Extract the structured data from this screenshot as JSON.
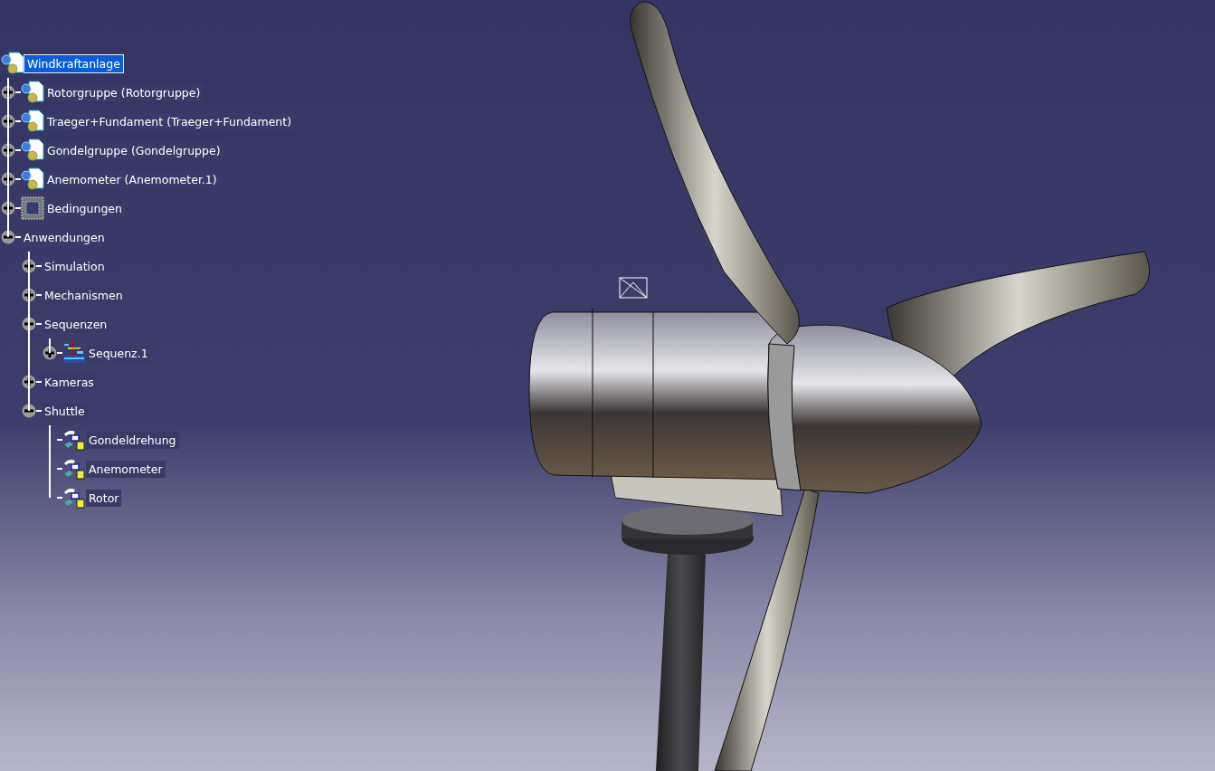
{
  "tree": {
    "label": "Windkraftanlage",
    "kind": "product",
    "selected": true,
    "children": [
      {
        "label": "Rotorgruppe (Rotorgruppe)",
        "kind": "product",
        "selected": false,
        "expanded": false
      },
      {
        "label": "Traeger+Fundament (Traeger+Fundament)",
        "kind": "product",
        "selected": false,
        "expanded": false
      },
      {
        "label": "Gondelgruppe (Gondelgruppe)",
        "kind": "product",
        "selected": false,
        "expanded": false
      },
      {
        "label": "Anemometer (Anemometer.1)",
        "kind": "product",
        "selected": false,
        "expanded": false
      },
      {
        "label": "Bedingungen",
        "kind": "constraints",
        "selected": false,
        "expanded": false
      },
      {
        "label": "Anwendungen",
        "selected": false,
        "expanded": true,
        "children": [
          {
            "label": "Simulation",
            "selected": false,
            "expanded": false
          },
          {
            "label": "Mechanismen",
            "selected": false,
            "expanded": false
          },
          {
            "label": "Sequenzen",
            "selected": false,
            "expanded": true,
            "children": [
              {
                "label": "Sequenz.1",
                "kind": "sequence",
                "selected": false,
                "expanded": false
              }
            ]
          },
          {
            "label": "Kameras",
            "selected": false,
            "expanded": false
          },
          {
            "label": "Shuttle",
            "selected": false,
            "expanded": true,
            "children": [
              {
                "label": "Gondeldrehung",
                "kind": "shuttle",
                "selected": false
              },
              {
                "label": "Anemometer",
                "kind": "shuttle",
                "selected": false
              },
              {
                "label": "Rotor",
                "kind": "shuttle",
                "selected": false
              }
            ]
          }
        ]
      }
    ]
  }
}
